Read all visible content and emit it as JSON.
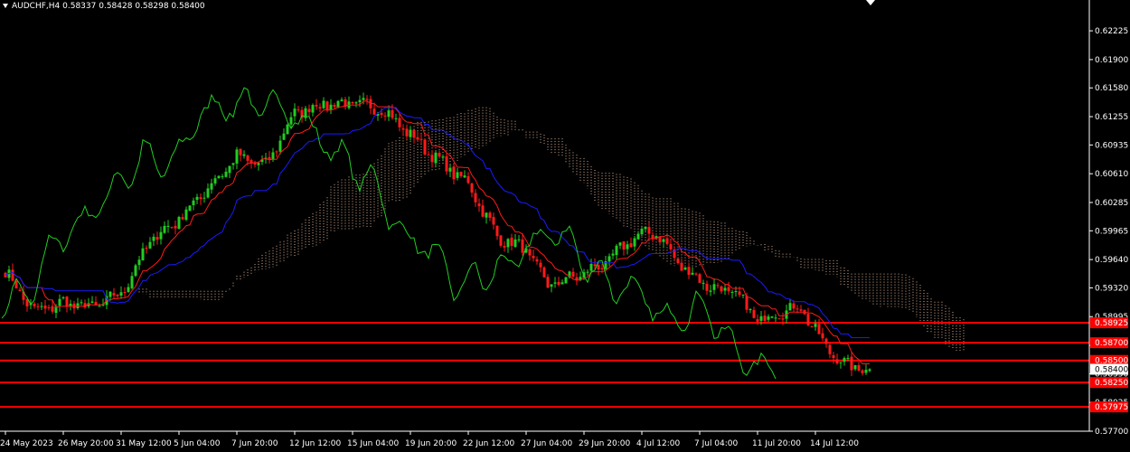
{
  "header": {
    "symbol": "AUDCHF,H4",
    "open": "0.58337",
    "high": "0.58428",
    "low": "0.58298",
    "close": "0.58400"
  },
  "colors": {
    "background": "#000000",
    "axis": "#ffffff",
    "bull": "#22cc22",
    "bear": "#ff1a1a",
    "tenkan": "#ff1a1a",
    "kijun": "#1a1aff",
    "chikou": "#22cc22",
    "cloud": "#ffd0b0",
    "level": "#ff0000"
  },
  "chart_data": {
    "type": "candlestick",
    "ylim": [
      0.577,
      0.6242
    ],
    "price_ticks": [
      "0.62225",
      "0.61900",
      "0.61580",
      "0.61255",
      "0.60935",
      "0.60610",
      "0.60285",
      "0.59965",
      "0.59640",
      "0.59320",
      "0.58995",
      "0.58670",
      "0.58350",
      "0.58025",
      "0.57700"
    ],
    "time_ticks": [
      {
        "label": "24 May 2023",
        "bar": 0
      },
      {
        "label": "26 May 20:00",
        "bar": 16
      },
      {
        "label": "31 May 12:00",
        "bar": 32
      },
      {
        "label": "5 Jun 04:00",
        "bar": 48
      },
      {
        "label": "7 Jun 20:00",
        "bar": 64
      },
      {
        "label": "12 Jun 12:00",
        "bar": 80
      },
      {
        "label": "15 Jun 04:00",
        "bar": 96
      },
      {
        "label": "19 Jun 20:00",
        "bar": 112
      },
      {
        "label": "22 Jun 12:00",
        "bar": 128
      },
      {
        "label": "27 Jun 04:00",
        "bar": 144
      },
      {
        "label": "29 Jun 20:00",
        "bar": 160
      },
      {
        "label": "4 Jul 12:00",
        "bar": 176
      },
      {
        "label": "7 Jul 04:00",
        "bar": 192
      },
      {
        "label": "11 Jul 20:00",
        "bar": 208
      },
      {
        "label": "14 Jul 12:00",
        "bar": 224
      }
    ],
    "levels": [
      {
        "price": 0.58925,
        "label": "0.58925"
      },
      {
        "price": 0.587,
        "label": "0.58700"
      },
      {
        "price": 0.585,
        "label": "0.58500"
      },
      {
        "price": 0.5825,
        "label": "0.58250"
      },
      {
        "price": 0.57975,
        "label": "0.57975"
      }
    ],
    "current_price": "0.58400",
    "close_anchors": [
      [
        0,
        0.595
      ],
      [
        8,
        0.5905
      ],
      [
        16,
        0.5915
      ],
      [
        24,
        0.591
      ],
      [
        32,
        0.5925
      ],
      [
        40,
        0.5985
      ],
      [
        48,
        0.601
      ],
      [
        56,
        0.6045
      ],
      [
        64,
        0.608
      ],
      [
        72,
        0.607
      ],
      [
        80,
        0.613
      ],
      [
        88,
        0.614
      ],
      [
        96,
        0.614
      ],
      [
        104,
        0.6135
      ],
      [
        112,
        0.6105
      ],
      [
        120,
        0.6075
      ],
      [
        128,
        0.605
      ],
      [
        136,
        0.599
      ],
      [
        144,
        0.5975
      ],
      [
        150,
        0.5935
      ],
      [
        158,
        0.5945
      ],
      [
        166,
        0.596
      ],
      [
        174,
        0.599
      ],
      [
        180,
        0.5995
      ],
      [
        186,
        0.596
      ],
      [
        194,
        0.5935
      ],
      [
        202,
        0.5925
      ],
      [
        208,
        0.5895
      ],
      [
        214,
        0.5905
      ],
      [
        220,
        0.591
      ],
      [
        226,
        0.587
      ],
      [
        232,
        0.5845
      ],
      [
        239,
        0.584
      ]
    ],
    "num_bars": 240
  }
}
